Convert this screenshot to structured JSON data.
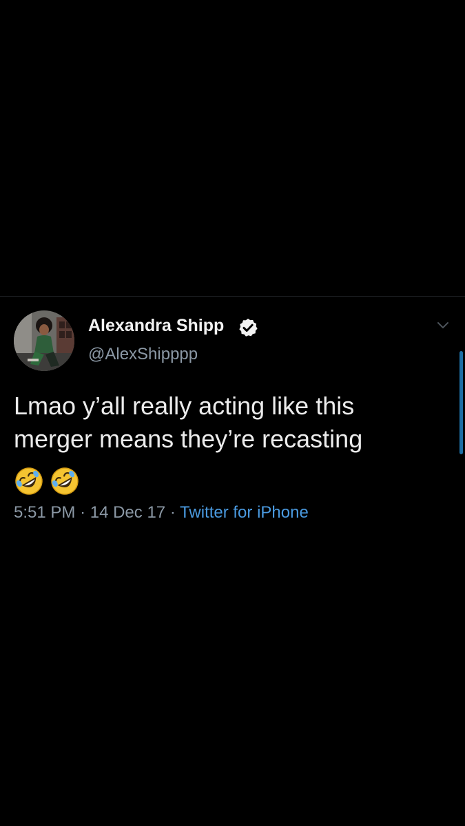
{
  "tweet": {
    "display_name": "Alexandra Shipp",
    "handle": "@AlexShipppp",
    "text_lines": [
      "Lmao y’all really acting like this",
      "merger means they’re recasting"
    ],
    "emojis": [
      "rolling-on-floor-laughing-emoji",
      "rolling-on-floor-laughing-emoji"
    ],
    "time": "5:51 PM",
    "date": "14 Dec 17",
    "separator": "·",
    "source": "Twitter for iPhone",
    "verified": true
  },
  "icons": {
    "verified": "verified-badge-icon",
    "caret": "chevron-down-icon"
  },
  "colors": {
    "background": "#000000",
    "link": "#4a9ae0",
    "secondary_text": "#8b98a5",
    "scroll_indicator": "#1d6fa5"
  }
}
